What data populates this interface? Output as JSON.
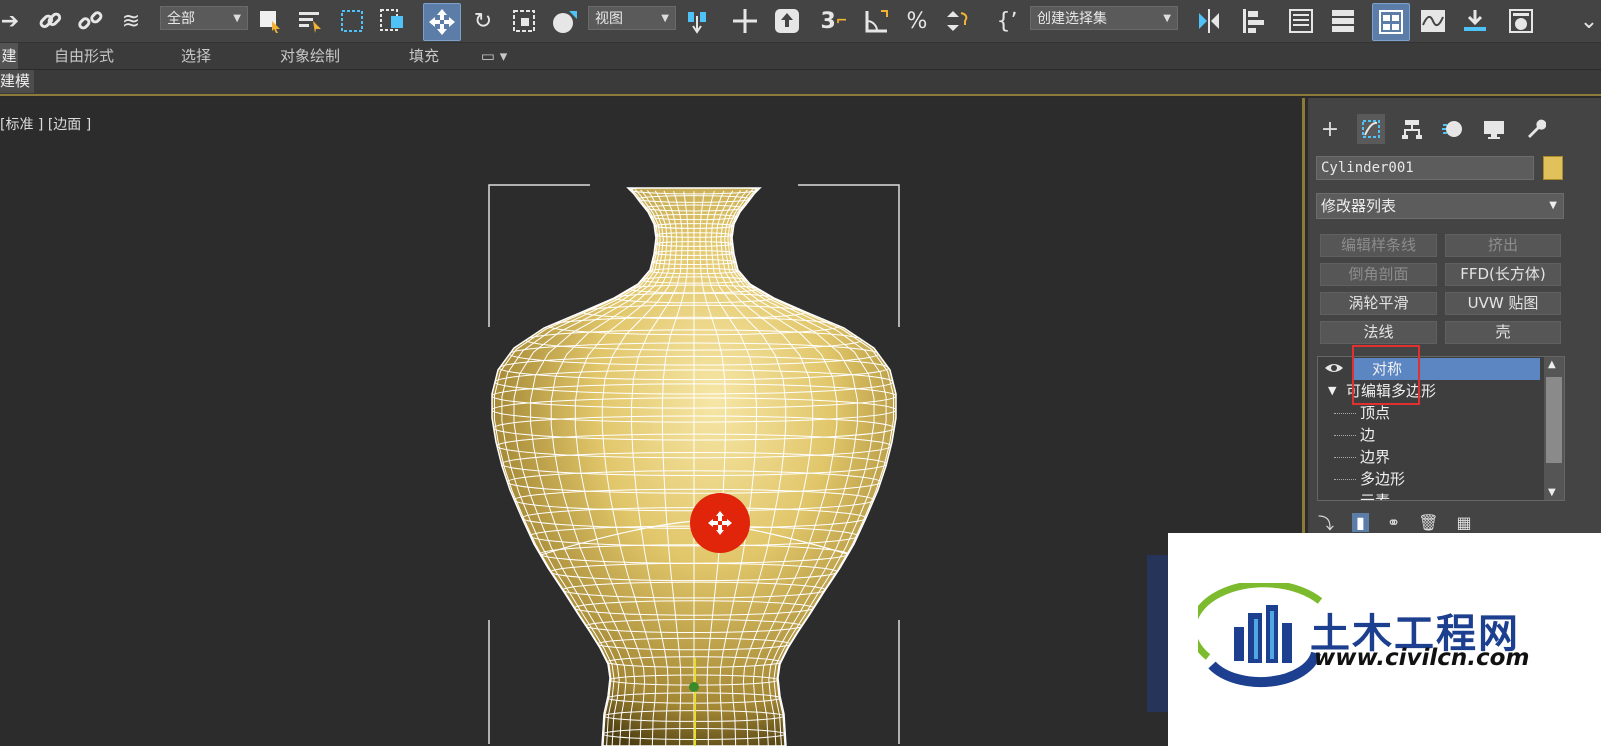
{
  "toolbar": {
    "filter_dropdown": "全部",
    "coord_dropdown": "视图",
    "selection_set_dropdown": "创建选择集",
    "snap_3d_label": "3"
  },
  "ribbon": {
    "tabs": [
      "建",
      "自由形式",
      "选择",
      "对象绘制",
      "填充"
    ],
    "subtab": "建模"
  },
  "viewport": {
    "label": "[标准 ] [边面 ]",
    "object_color": "#e3c96a",
    "wire_color": "#ffffff",
    "gizmo_color": "#e0250b"
  },
  "panel": {
    "object_name": "Cylinder001",
    "object_color": "#e1c15a",
    "modifier_list": "修改器列表",
    "modifier_buttons": [
      {
        "label": "编辑样条线",
        "enabled": false
      },
      {
        "label": "挤出",
        "enabled": false
      },
      {
        "label": "倒角剖面",
        "enabled": false
      },
      {
        "label": "FFD(长方体)",
        "enabled": true
      },
      {
        "label": "涡轮平滑",
        "enabled": true
      },
      {
        "label": "UVW 贴图",
        "enabled": true
      },
      {
        "label": "法线",
        "enabled": true
      },
      {
        "label": "壳",
        "enabled": true
      }
    ],
    "stack": {
      "selected": "对称",
      "base": "可编辑多边形",
      "subobjects": [
        "顶点",
        "边",
        "边界",
        "多边形",
        "元素"
      ]
    }
  },
  "watermark": {
    "title": "土木工程网",
    "url": "www.civilcn.com"
  }
}
